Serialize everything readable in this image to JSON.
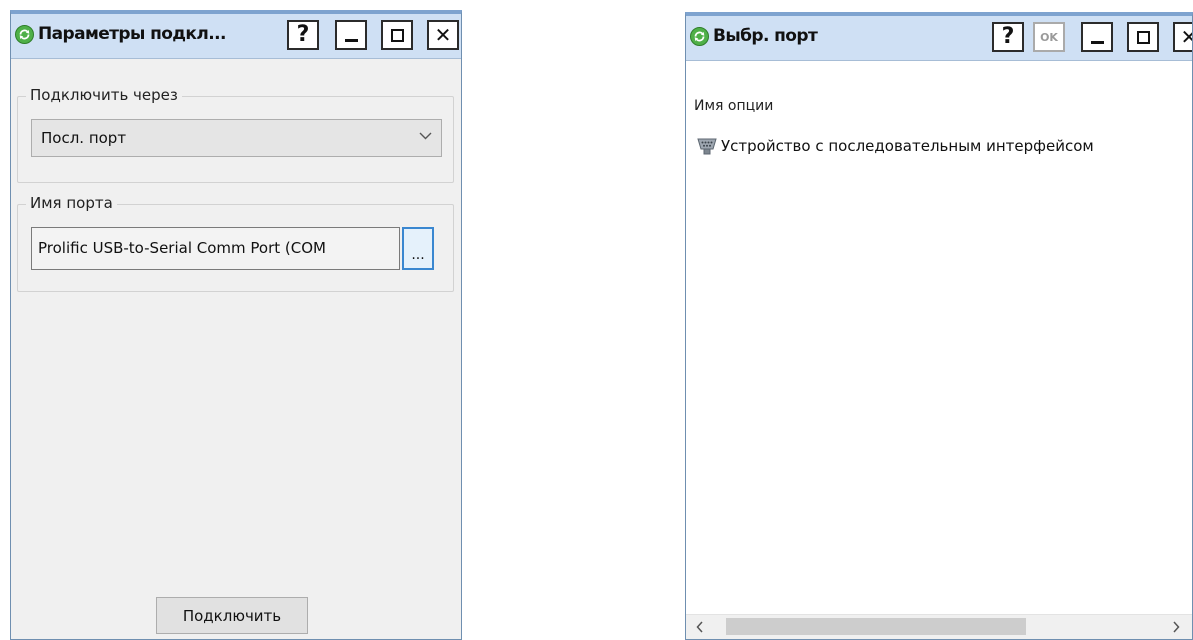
{
  "left_window": {
    "title": "Параметры подкл...",
    "help_glyph": "?",
    "close_glyph": "✕",
    "connect_via": {
      "label": "Подключить через",
      "selected": "Посл. порт"
    },
    "port_name": {
      "label": "Имя порта",
      "value": "Prolific USB-to-Serial Comm Port (COM",
      "browse_label": "..."
    },
    "connect_button": "Подключить"
  },
  "right_window": {
    "title": "Выбр. порт",
    "help_glyph": "?",
    "ok_glyph": "OK",
    "close_glyph": "✕",
    "column_header": "Имя опции",
    "items": [
      {
        "label": "Устройство с последовательным интерфейсом",
        "icon": "serial-port-icon"
      }
    ],
    "scroll_left": "‹",
    "scroll_right": "›"
  },
  "colors": {
    "titlebar": "#cfe0f4",
    "window_border": "#7ea3cf",
    "app_icon": "#4fb048",
    "focus_blue": "#3a87d0"
  }
}
